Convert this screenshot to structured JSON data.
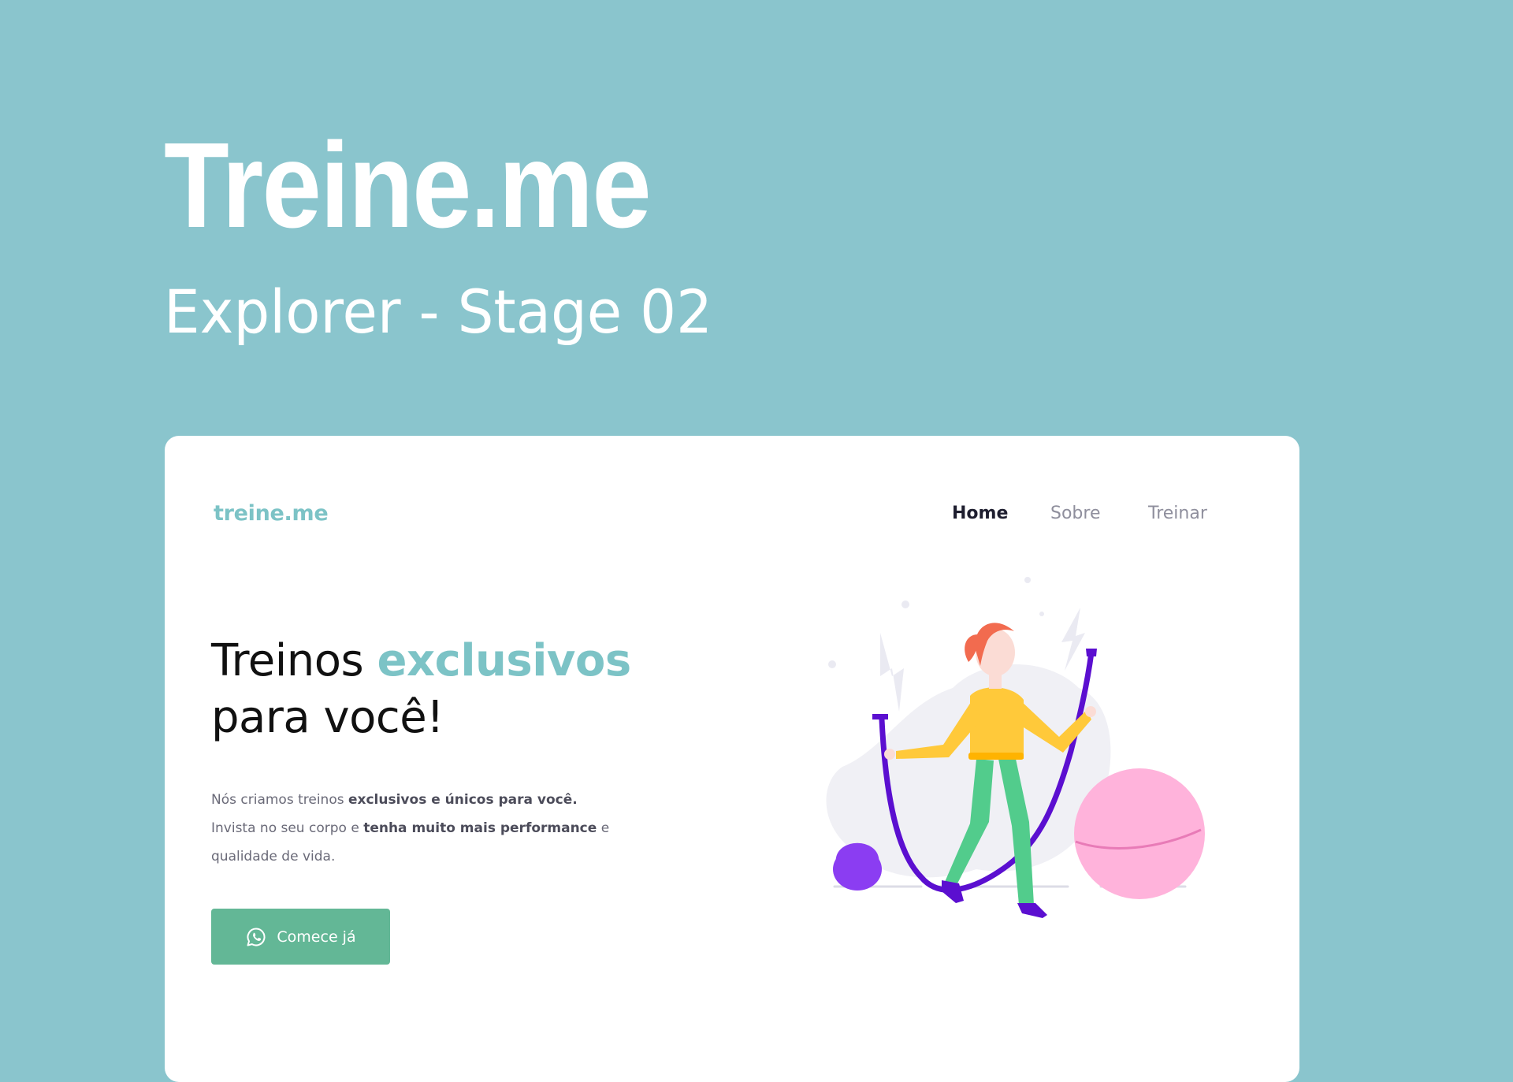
{
  "cover": {
    "title": "Treine.me",
    "subtitle": "Explorer - Stage 02"
  },
  "site": {
    "logo": "treine.me",
    "nav": [
      {
        "label": "Home",
        "active": true
      },
      {
        "label": "Sobre",
        "active": false
      },
      {
        "label": "Treinar",
        "active": false
      }
    ],
    "headline": {
      "part1": "Treinos ",
      "accent": "exclusivos",
      "part2": "para você!"
    },
    "description": {
      "line1_text": "Nós criamos treinos ",
      "line1_bold": "exclusivos e únicos para você.",
      "line2_text": "Invista no seu corpo e ",
      "line2_bold": "tenha muito mais performance",
      "line2_tail": " e qualidade de vida."
    },
    "cta": {
      "label": "Comece já",
      "icon": "whatsapp-icon"
    },
    "illustration": {
      "subject": "woman-jumping-rope",
      "props": [
        "kettlebell",
        "exercise-ball",
        "jump-rope"
      ]
    }
  },
  "colors": {
    "page_background": "#8AC5CD",
    "brand_accent": "#7CC3C6",
    "cta_green": "#63B796",
    "rope_purple": "#5B0FD0",
    "kettlebell_purple": "#8B3DF2",
    "ball_pink": "#FFB3DB",
    "shirt_yellow": "#FFC93A",
    "pants_green": "#52CC8C",
    "hair_orange": "#F26B4F"
  }
}
